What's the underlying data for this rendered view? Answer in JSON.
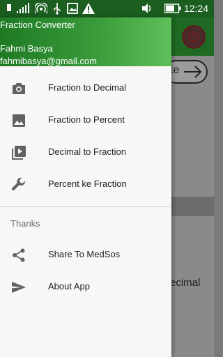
{
  "status_bar": {
    "time": "12:24",
    "icons": [
      "sim-signal-icon",
      "wifi-hotspot-icon",
      "usb-icon",
      "gallery-notification-icon",
      "warning-icon",
      "vibrate-icon",
      "battery-icon"
    ]
  },
  "background": {
    "partial_button_text": "te",
    "partial_text": "ecimal",
    "power_color": "#d32f2f"
  },
  "drawer": {
    "header": {
      "app_title": "Fraction Converter",
      "user_name": "Fahmi Basya",
      "user_email": "fahmibasya@gmail.com"
    },
    "items": [
      {
        "label": "Fraction to Decimal",
        "icon": "camera-icon"
      },
      {
        "label": "Fraction to Percent",
        "icon": "image-icon"
      },
      {
        "label": "Decimal to Fraction",
        "icon": "video-library-icon"
      },
      {
        "label": "Percent ke Fraction",
        "icon": "wrench-icon"
      }
    ],
    "section_label": "Thanks",
    "section_items": [
      {
        "label": "Share To MedSos",
        "icon": "share-icon"
      },
      {
        "label": "About App",
        "icon": "send-icon"
      }
    ]
  },
  "colors": {
    "status_bar": "#1b5e20",
    "header_gradient_start": "#1e7a24",
    "header_gradient_end": "#5fbf5a",
    "drawer_bg": "#f7f7f7"
  }
}
